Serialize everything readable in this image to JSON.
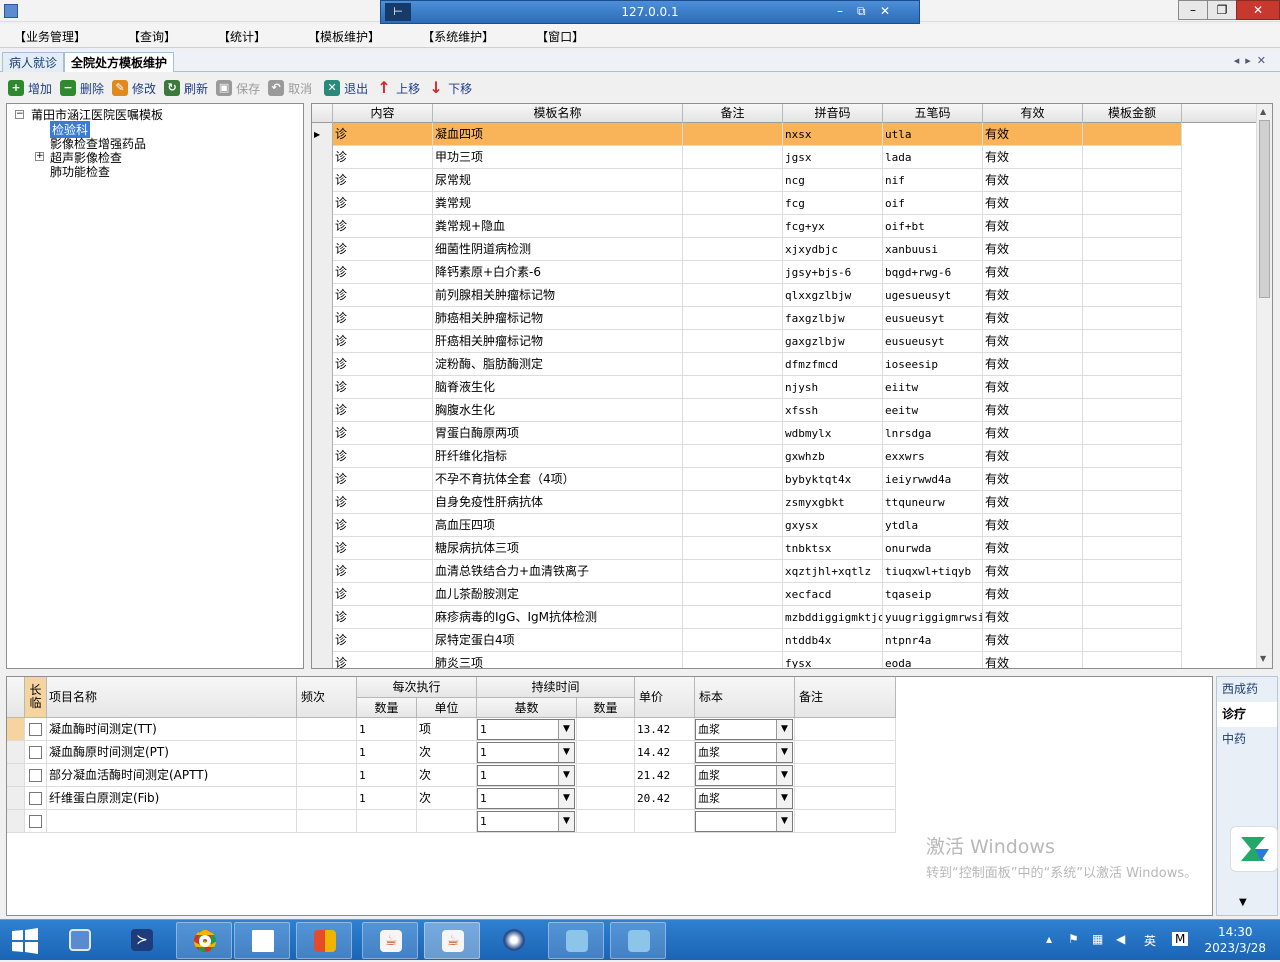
{
  "window": {
    "remote_title": "127.0.0.1",
    "pin_icon": "pin-icon"
  },
  "menu": [
    "【业务管理】",
    "【查询】",
    "【统计】",
    "【模板维护】",
    "【系统维护】",
    "【窗口】"
  ],
  "tabs": [
    "病人就诊",
    "全院处方模板维护"
  ],
  "toolbar": [
    {
      "label": "增加",
      "icon": "add-icon",
      "color": "#2f8a2f",
      "enabled": true
    },
    {
      "label": "删除",
      "icon": "delete-icon",
      "color": "#2f8a2f",
      "enabled": true
    },
    {
      "label": "修改",
      "icon": "edit-icon",
      "color": "#e08a1e",
      "enabled": true
    },
    {
      "label": "刷新",
      "icon": "refresh-icon",
      "color": "#3c7a3c",
      "enabled": true
    },
    {
      "label": "保存",
      "icon": "save-icon",
      "color": "#9a9a9a",
      "enabled": false
    },
    {
      "label": "取消",
      "icon": "undo-icon",
      "color": "#9a9a9a",
      "enabled": false
    },
    {
      "label": "退出",
      "icon": "exit-icon",
      "color": "#2a8a7a",
      "enabled": true
    },
    {
      "label": "上移",
      "icon": "arrow-up-icon",
      "color": "#d02a2a",
      "enabled": true
    },
    {
      "label": "下移",
      "icon": "arrow-down-icon",
      "color": "#d02a2a",
      "enabled": true
    }
  ],
  "tree": {
    "root": "莆田市涵江医院医嘱模板",
    "children": [
      "检验科",
      "影像检查增强药品",
      "超声影像检查",
      "肺功能检查"
    ],
    "selected": "检验科"
  },
  "grid": {
    "headers": [
      "内容",
      "模板名称",
      "备注",
      "拼音码",
      "五笔码",
      "有效",
      "模板金额"
    ],
    "rows": [
      [
        "诊",
        "凝血四项",
        "",
        "nxsx",
        "utla",
        "有效",
        ""
      ],
      [
        "诊",
        "甲功三项",
        "",
        "jgsx",
        "lada",
        "有效",
        ""
      ],
      [
        "诊",
        "尿常规",
        "",
        "ncg",
        "nif",
        "有效",
        ""
      ],
      [
        "诊",
        "粪常规",
        "",
        "fcg",
        "oif",
        "有效",
        ""
      ],
      [
        "诊",
        "粪常规+隐血",
        "",
        "fcg+yx",
        "oif+bt",
        "有效",
        ""
      ],
      [
        "诊",
        "细菌性阴道病检测",
        "",
        "xjxydbjc",
        "xanbuusi",
        "有效",
        ""
      ],
      [
        "诊",
        "降钙素原+白介素-6",
        "",
        "jgsy+bjs-6",
        "bqgd+rwg-6",
        "有效",
        ""
      ],
      [
        "诊",
        "前列腺相关肿瘤标记物",
        "",
        "qlxxgzlbjw",
        "ugesueusyt",
        "有效",
        ""
      ],
      [
        "诊",
        "肺癌相关肿瘤标记物",
        "",
        "faxgzlbjw",
        "eusueusyt",
        "有效",
        ""
      ],
      [
        "诊",
        "肝癌相关肿瘤标记物",
        "",
        "gaxgzlbjw",
        "eusueusyt",
        "有效",
        ""
      ],
      [
        "诊",
        "淀粉酶、脂肪酶测定",
        "",
        "dfmzfmcd",
        "ioseesip",
        "有效",
        ""
      ],
      [
        "诊",
        "脑脊液生化",
        "",
        "njysh",
        "eiitw",
        "有效",
        ""
      ],
      [
        "诊",
        "胸腹水生化",
        "",
        "xfssh",
        "eeitw",
        "有效",
        ""
      ],
      [
        "诊",
        "胃蛋白酶原两项",
        "",
        "wdbmylx",
        "lnrsdga",
        "有效",
        ""
      ],
      [
        "诊",
        "肝纤维化指标",
        "",
        "gxwhzb",
        "exxwrs",
        "有效",
        ""
      ],
      [
        "诊",
        "不孕不育抗体全套（4项）",
        "",
        "bybyktqt4x",
        "ieiyrwwd4a",
        "有效",
        ""
      ],
      [
        "诊",
        "自身免疫性肝病抗体",
        "",
        "zsmyxgbkt",
        "ttquneurw",
        "有效",
        ""
      ],
      [
        "诊",
        "高血压四项",
        "",
        "gxysx",
        "ytdla",
        "有效",
        ""
      ],
      [
        "诊",
        "糖尿病抗体三项",
        "",
        "tnbktsx",
        "onurwda",
        "有效",
        ""
      ],
      [
        "诊",
        "血清总铁结合力+血清铁离子",
        "",
        "xqztjhl+xqtlz",
        "tiuqxwl+tiqyb",
        "有效",
        ""
      ],
      [
        "诊",
        "血儿茶酚胺测定",
        "",
        "xecfacd",
        "tqaseip",
        "有效",
        ""
      ],
      [
        "诊",
        "麻疹病毒的IgG、IgM抗体检测",
        "",
        "mzbddiggigmktjc",
        "yuugriggigmrwsi",
        "有效",
        ""
      ],
      [
        "诊",
        "尿特定蛋白4项",
        "",
        "ntddb4x",
        "ntpnr4a",
        "有效",
        ""
      ],
      [
        "诊",
        "肺炎三项",
        "",
        "fysx",
        "eoda",
        "有效",
        ""
      ]
    ],
    "selected_row": 0
  },
  "detail": {
    "headers": {
      "long": "长临",
      "name": "项目名称",
      "freq": "频次",
      "each": "每次执行",
      "each_qty": "数量",
      "each_unit": "单位",
      "dur": "持续时间",
      "dur_base": "基数",
      "dur_qty": "数量",
      "price": "单价",
      "specimen": "标本",
      "remark": "备注"
    },
    "rows": [
      {
        "name": "凝血酶时间测定(TT)",
        "qty": "1",
        "unit": "项",
        "base": "1",
        "price": "13.42",
        "specimen": "血浆"
      },
      {
        "name": "凝血酶原时间测定(PT)",
        "qty": "1",
        "unit": "次",
        "base": "1",
        "price": "14.42",
        "specimen": "血浆"
      },
      {
        "name": "部分凝血活酶时间测定(APTT)",
        "qty": "1",
        "unit": "次",
        "base": "1",
        "price": "21.42",
        "specimen": "血浆"
      },
      {
        "name": "纤维蛋白原测定(Fib)",
        "qty": "1",
        "unit": "次",
        "base": "1",
        "price": "20.42",
        "specimen": "血浆"
      },
      {
        "name": "",
        "qty": "",
        "unit": "",
        "base": "1",
        "price": "",
        "specimen": ""
      }
    ]
  },
  "side_tabs": [
    "西成药",
    "诊疗",
    "中药"
  ],
  "side_active": 1,
  "watermark": {
    "line1": "激活 Windows",
    "line2": "转到“控制面板”中的“系统”以激活 Windows。"
  },
  "taskbar": {
    "apps": [
      "start-button",
      "server-manager-icon",
      "powershell-icon",
      "chrome-icon",
      "file-icon",
      "tiles-icon",
      "java-icon",
      "java-icon-active",
      "compass-icon",
      "user-app-icon",
      "user-app-icon-2"
    ],
    "tray_lang": "英",
    "tray_ime": "M",
    "time": "14:30",
    "date": "2023/3/28"
  }
}
